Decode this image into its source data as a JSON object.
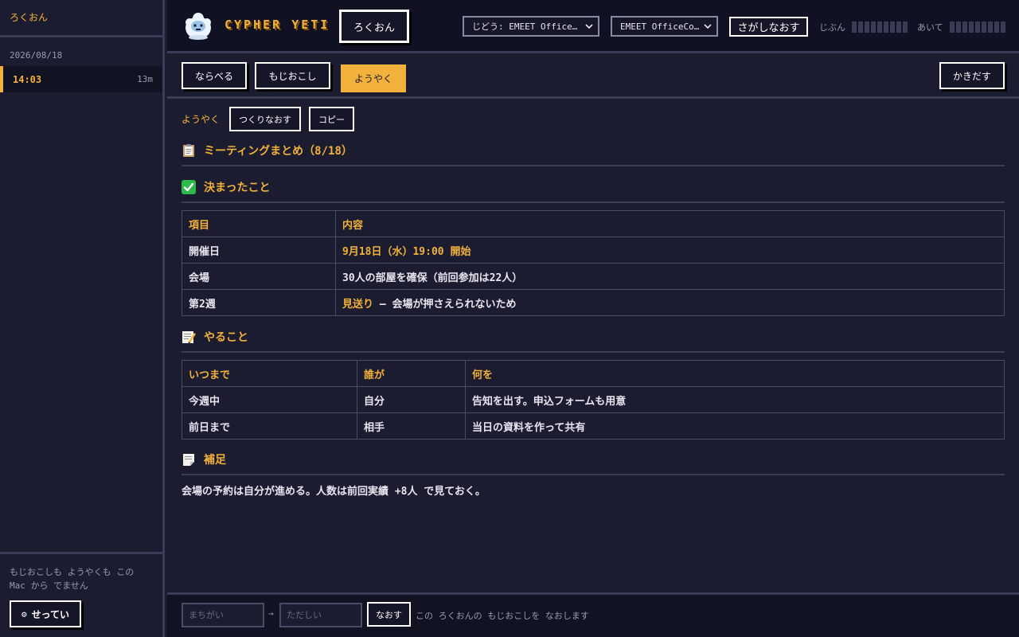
{
  "sidebar": {
    "header": "ろくおん",
    "date": "2026/08/18",
    "items": [
      {
        "time": "14:03",
        "duration": "13m"
      }
    ],
    "footer_note": "もじおこしも ようやくも この Mac から でません",
    "settings_label": "せってい"
  },
  "topbar": {
    "brand": "CYPHER YETI",
    "record_label": "ろくおん",
    "mic_select": "じどう: EMEET Office…",
    "output_select": "EMEET OfficeCo…",
    "search_label": "さがしなおす",
    "self_label": "じぶん",
    "other_label": "あいて",
    "meter_levels": {
      "self": 0,
      "other": 0
    }
  },
  "toolbar": {
    "arrange": "ならべる",
    "transcribe": "もじおこし",
    "summary": "ようやく",
    "export": "かきだす"
  },
  "summary": {
    "label": "ようやく",
    "regenerate": "つくりなおす",
    "copy": "コピー",
    "title": "ミーティングまとめ（8/18）",
    "decided": {
      "heading": "決まったこと",
      "headers": [
        "項目",
        "内容"
      ],
      "rows": [
        {
          "item": "開催日",
          "content": "9月18日（水）19:00 開始"
        },
        {
          "item": "会場",
          "content": "30人の部屋を確保（前回参加は22人）"
        },
        {
          "item": "第2週",
          "content_hl": "見送り",
          "content_rest": " — 会場が押さえられないため"
        }
      ]
    },
    "todo": {
      "heading": "やること",
      "headers": [
        "いつまで",
        "誰が",
        "何を"
      ],
      "rows": [
        {
          "when": "今週中",
          "who": "自分",
          "what": "告知を出す。申込フォームも用意"
        },
        {
          "when": "前日まで",
          "who": "相手",
          "what": "当日の資料を作って共有"
        }
      ]
    },
    "notes": {
      "heading": "補足",
      "text": "会場の予約は自分が進める。人数は前回実績 +8人 で見ておく。"
    }
  },
  "bottombar": {
    "wrong_placeholder": "まちがい",
    "arrow": "→",
    "right_placeholder": "ただしい",
    "fix_label": "なおす",
    "note": "この ろくおんの もじおこしを なおします"
  },
  "colors": {
    "accent": "#f2b13a",
    "background": "#1b1c30",
    "topbar": "#101122",
    "border": "#3b3d58"
  },
  "icons": {
    "logo": "yeti-logo-icon",
    "title": "clipboard-icon",
    "decided": "check-mark-icon",
    "todo": "memo-icon",
    "notes": "note-page-icon",
    "settings": "gear-icon",
    "select": "chevron-down-icon"
  }
}
